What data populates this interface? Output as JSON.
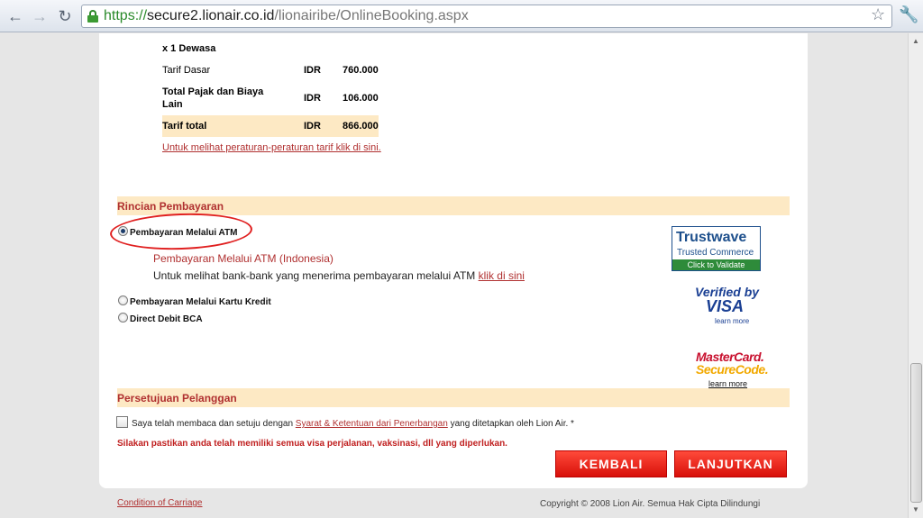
{
  "browser": {
    "url_scheme": "https://",
    "url_host": "secure2.lionair.co.id",
    "url_path": "/lionairibe/OnlineBooking.aspx"
  },
  "fare": {
    "passenger": "x 1 Dewasa",
    "rows": [
      {
        "label": "Tarif Dasar",
        "currency": "IDR",
        "amount": "760.000"
      },
      {
        "label": "Total Pajak dan Biaya",
        "label2": "Lain",
        "currency": "IDR",
        "amount": "106.000"
      },
      {
        "label": "Tarif total",
        "currency": "IDR",
        "amount": "866.000"
      }
    ],
    "rules_link": "Untuk melihat peraturan-peraturan tarif klik di sini."
  },
  "payment": {
    "section_title": "Rincian Pembayaran",
    "options": [
      {
        "label": "Pembayaran Melalui ATM",
        "selected": true
      },
      {
        "label": "Pembayaran Melalui Kartu Kredit",
        "selected": false
      },
      {
        "label": "Direct Debit BCA",
        "selected": false
      }
    ],
    "atm_title": "Pembayaran Melalui ATM (Indonesia)",
    "atm_desc": "Untuk melihat bank-bank yang menerima pembayaran melalui ATM",
    "atm_link": "klik di sini"
  },
  "badges": {
    "trustwave_name": "Trustwave",
    "trustwave_sub": "Trusted Commerce",
    "trustwave_cta": "Click to Validate",
    "visa_line1": "Verified by",
    "visa_line2": "VISA",
    "visa_learn": "learn more",
    "mc_line1": "MasterCard.",
    "mc_line2": "SecureCode.",
    "mc_learn": "learn more"
  },
  "agreement": {
    "section_title": "Persetujuan Pelanggan",
    "text_before": "Saya telah membaca dan setuju dengan",
    "terms_link": "Syarat & Ketentuan dari Penerbangan",
    "text_after": "yang ditetapkan oleh Lion Air. *",
    "warning": "Silakan pastikan anda telah memiliki semua visa perjalanan, vaksinasi, dll yang diperlukan."
  },
  "buttons": {
    "back": "KEMBALI",
    "next": "LANJUTKAN"
  },
  "footer": {
    "carriage_link": "Condition of Carriage",
    "copyright": "Copyright © 2008 Lion Air. Semua Hak Cipta Dilindungi"
  },
  "colors": {
    "accent_red": "#b03030",
    "section_bg": "#fde9c4",
    "button_red": "#e8241c"
  }
}
